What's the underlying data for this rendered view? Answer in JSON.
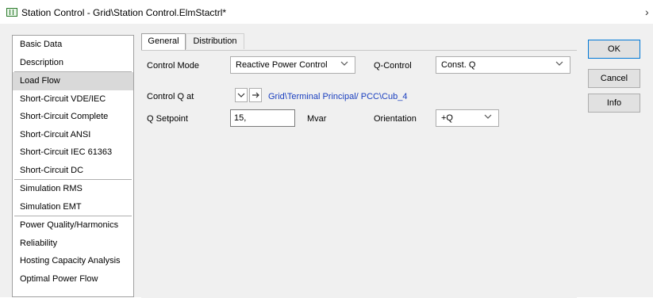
{
  "window": {
    "title": "Station Control - Grid\\Station Control.ElmStactrl*",
    "close_glyph": "›"
  },
  "nav": {
    "items": [
      {
        "label": "Basic Data"
      },
      {
        "label": "Description"
      },
      {
        "label": "Load Flow",
        "selected": true
      },
      {
        "label": "Short-Circuit VDE/IEC"
      },
      {
        "label": "Short-Circuit Complete"
      },
      {
        "label": "Short-Circuit ANSI"
      },
      {
        "label": "Short-Circuit IEC 61363"
      },
      {
        "label": "Short-Circuit DC"
      },
      {
        "label": "Simulation RMS"
      },
      {
        "label": "Simulation EMT"
      },
      {
        "label": "Power Quality/Harmonics"
      },
      {
        "label": "Reliability"
      },
      {
        "label": "Hosting Capacity Analysis"
      },
      {
        "label": "Optimal Power Flow"
      }
    ]
  },
  "tabs": [
    {
      "label": "General",
      "active": true
    },
    {
      "label": "Distribution",
      "active": false
    }
  ],
  "form": {
    "control_mode": {
      "label": "Control Mode",
      "value": "Reactive Power Control"
    },
    "q_control": {
      "label": "Q-Control",
      "value": "Const. Q"
    },
    "control_q_at": {
      "label": "Control Q at",
      "link": "Grid\\Terminal Principal/ PCC\\Cub_4"
    },
    "q_setpoint": {
      "label": "Q Setpoint",
      "value": "15,",
      "unit": "Mvar"
    },
    "orientation": {
      "label": "Orientation",
      "value": "+Q"
    }
  },
  "buttons": {
    "ok": "OK",
    "cancel": "Cancel",
    "info": "Info"
  },
  "colors": {
    "link": "#1a3fbf",
    "default_button_border": "#0078d7"
  }
}
